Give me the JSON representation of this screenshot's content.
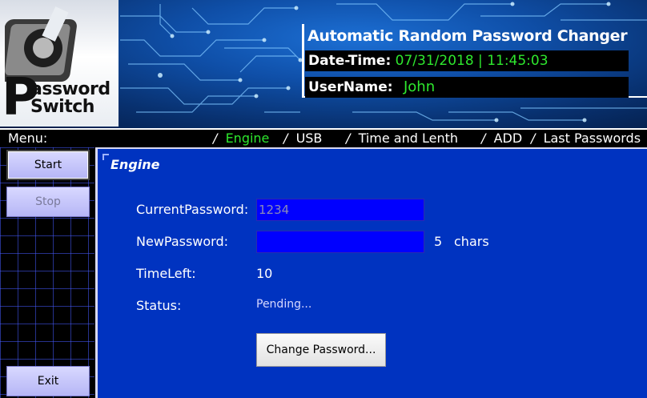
{
  "header": {
    "logo": {
      "line1": "assword",
      "line2": "Switch",
      "initial": "P"
    },
    "app_title": "Automatic Random Password Changer",
    "datetime_label": "Date-Time:",
    "datetime_value": "07/31/2018 | 11:45:03",
    "username_label": "UserName:",
    "username_value": "John",
    "accent_color": "#2ee82e"
  },
  "menu": {
    "label": "Menu:",
    "tabs": [
      {
        "label": "Engine",
        "active": true
      },
      {
        "label": "USB",
        "active": false
      },
      {
        "label": "Time and Lenth",
        "active": false
      },
      {
        "label": "ADD",
        "active": false
      },
      {
        "label": "Last Passwords",
        "active": false
      }
    ]
  },
  "sidebar": {
    "start_label": "Start",
    "stop_label": "Stop",
    "exit_label": "Exit"
  },
  "engine": {
    "title": "Engine",
    "current_password_label": "CurrentPassword:",
    "current_password_value": "1234",
    "new_password_label": "NewPassword:",
    "new_password_value": "",
    "chars_count": "5",
    "chars_unit": "chars",
    "time_left_label": "TimeLeft:",
    "time_left_value": "10",
    "status_label": "Status:",
    "status_value": "Pending...",
    "change_button_label": "Change Password..."
  }
}
